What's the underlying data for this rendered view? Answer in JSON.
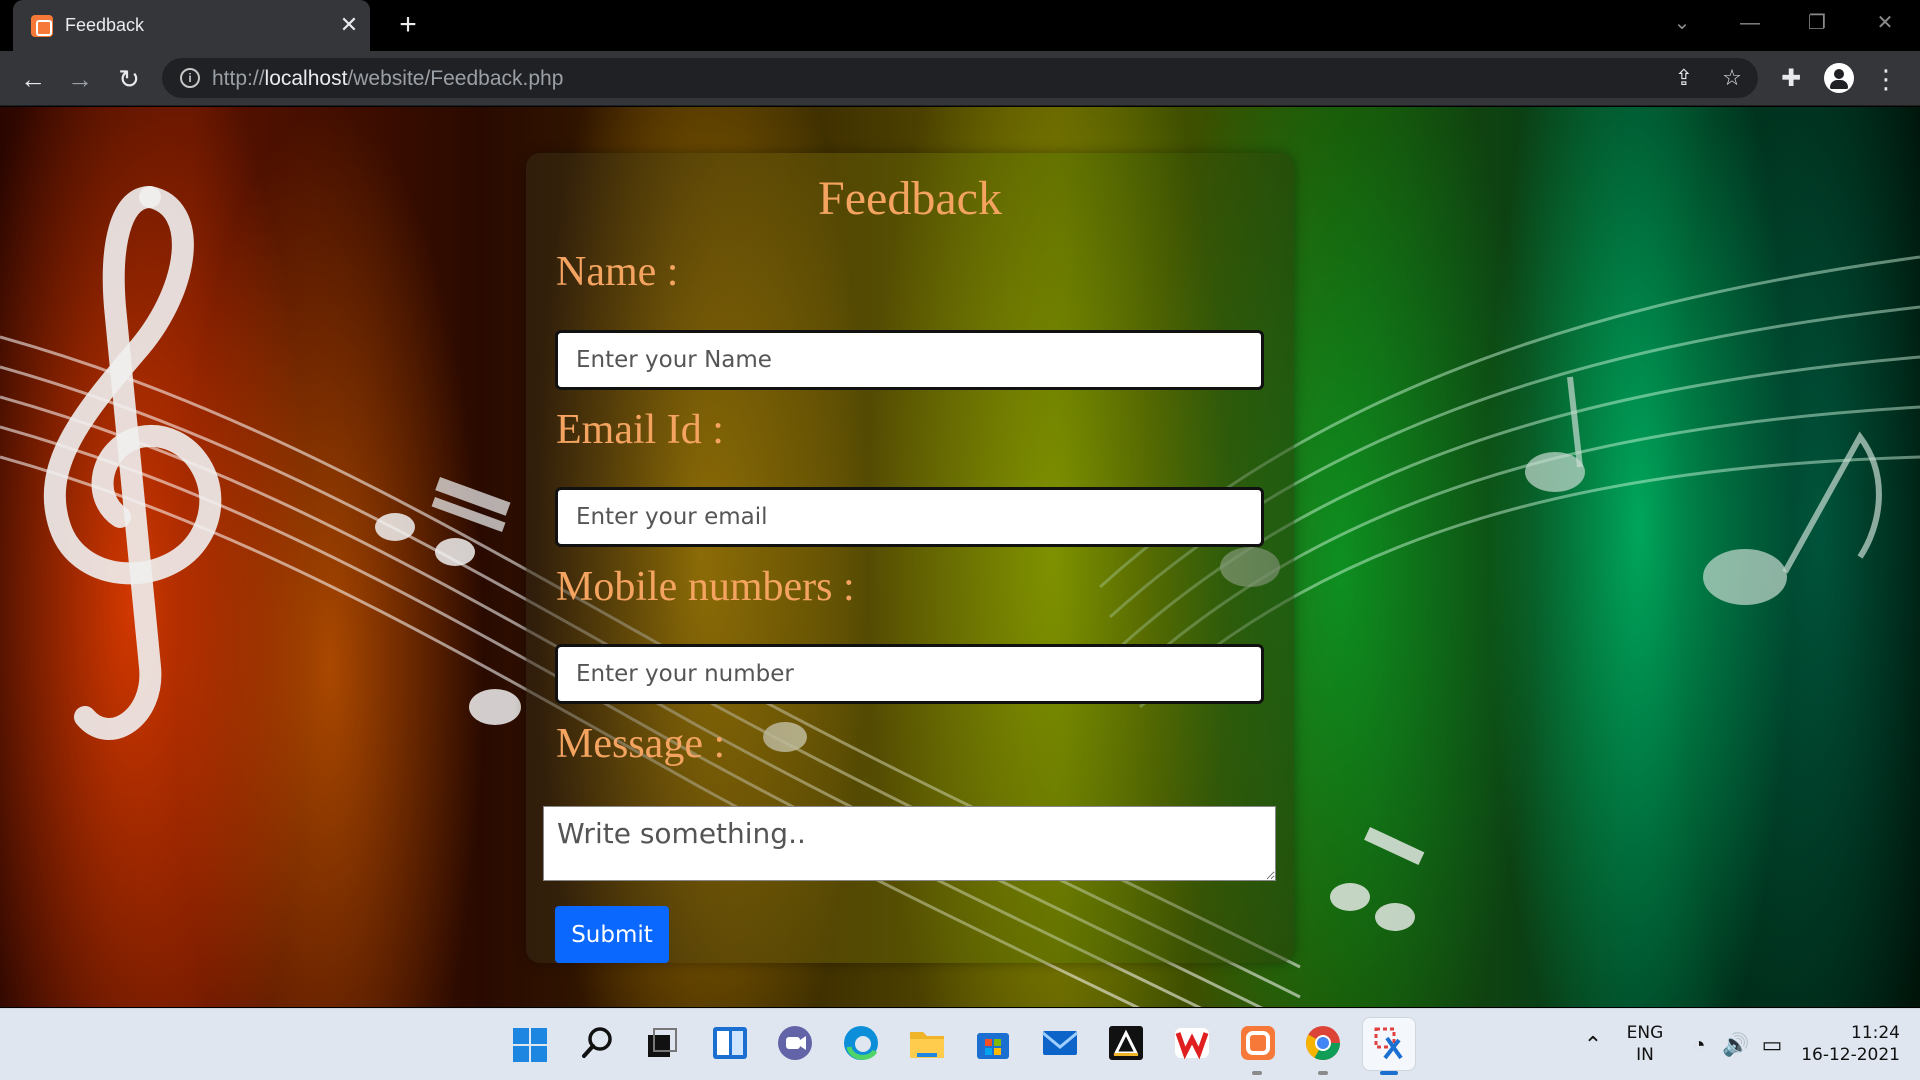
{
  "browser": {
    "tab_title": "Feedback",
    "tab_close": "✕",
    "new_tab": "+",
    "url_scheme": "http://",
    "url_host": "localhost",
    "url_path": "/website/Feedback.php"
  },
  "form": {
    "title": "Feedback",
    "name_label": "Name :",
    "name_placeholder": "Enter your Name",
    "email_label": "Email Id :",
    "email_placeholder": "Enter your email",
    "mobile_label": "Mobile numbers :",
    "mobile_placeholder": "Enter your number",
    "message_label": "Message :",
    "message_placeholder": "Write something..",
    "submit_label": "Submit"
  },
  "taskbar": {
    "language_line1": "ENG",
    "language_line2": "IN",
    "time": "11:24",
    "date": "16-12-2021"
  },
  "colors": {
    "form_text": "#f4a460",
    "submit_button": "#0a68ff"
  }
}
